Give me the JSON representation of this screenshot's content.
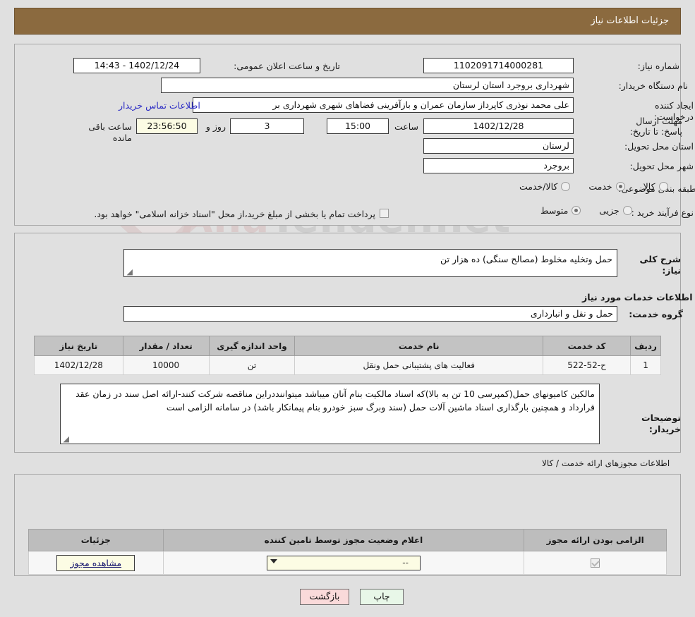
{
  "header": {
    "title": "جزئیات اطلاعات نیاز"
  },
  "need": {
    "number_label": "شماره نیاز:",
    "number_value": "1102091714000281",
    "announce_label": "تاریخ و ساعت اعلان عمومی:",
    "announce_value": "1402/12/24 - 14:43",
    "buyer_org_label": "نام دستگاه خریدار:",
    "buyer_org_value": "شهرداری بروجرد استان لرستان",
    "creator_label": "ایجاد کننده درخواست:",
    "creator_value": "علی محمد نوذری کاپرداز سازمان عمران و بازآفرینی فضاهای شهری شهرداری بر",
    "contact_link": "اطلاعات تماس خریدار",
    "deadline_label": "مهلت ارسال پاسخ: تا تاریخ:",
    "deadline_date": "1402/12/28",
    "time_label": "ساعت",
    "deadline_time": "15:00",
    "days_value": "3",
    "days_label": "روز و",
    "countdown_value": "23:56:50",
    "countdown_label": "ساعت باقی مانده",
    "province_label": "استان محل تحویل:",
    "province_value": "لرستان",
    "city_label": "شهر محل تحویل:",
    "city_value": "بروجرد",
    "category_label": "طبقه بندی موضوعی:",
    "category_options": [
      {
        "label": "کالا",
        "selected": false
      },
      {
        "label": "خدمت",
        "selected": true
      },
      {
        "label": "کالا/خدمت",
        "selected": false
      }
    ],
    "process_label": "نوع فرآیند خرید :",
    "process_options": [
      {
        "label": "جزیی",
        "selected": false
      },
      {
        "label": "متوسط",
        "selected": true
      }
    ],
    "treasury_checkbox_checked": false,
    "treasury_note": "پرداخت تمام یا بخشی از مبلغ خرید،از محل \"اسناد خزانه اسلامی\" خواهد بود."
  },
  "summary": {
    "label": "شرح کلی نیاز:",
    "value": "حمل وتخلیه مخلوط (مصالح سنگی) ده هزار تن"
  },
  "services_section": {
    "heading": "اطلاعات خدمات مورد نیاز",
    "group_label": "گروه خدمت:",
    "group_value": "حمل و نقل و انبارداری"
  },
  "services_table": {
    "columns": [
      "ردیف",
      "کد خدمت",
      "نام خدمت",
      "واحد اندازه گیری",
      "تعداد / مقدار",
      "تاریخ نیاز"
    ],
    "rows": [
      {
        "row": "1",
        "code": "ح-52-522",
        "name": "فعالیت های پشتیبانی حمل ونقل",
        "unit": "تن",
        "quantity": "10000",
        "date": "1402/12/28"
      }
    ]
  },
  "buyer_notes": {
    "label": "توضیحات خریدار:",
    "value": "مالکین کامیونهای حمل(کمپرسی 10 تن به بالا)که اسناد مالکیت بنام آنان میباشد میتواننددراین مناقصه شرکت کنند-ارائه اصل سند در زمان عقد قرارداد و همچنین بارگذاری اسناد ماشین آلات حمل (سند وبرگ سبز خودرو بنام پیمانکار باشد) در سامانه الزامی است"
  },
  "permits_section": {
    "heading": "اطلاعات مجوزهای ارائه خدمت / کالا",
    "columns": [
      "الزامی بودن ارائه مجوز",
      "اعلام وضعیت مجوز توسط تامین کننده",
      "جزئیات"
    ],
    "rows": [
      {
        "required_checked": true,
        "status_value": "--",
        "details_button": "مشاهده مجوز"
      }
    ]
  },
  "footer": {
    "print_label": "چاپ",
    "back_label": "بازگشت"
  },
  "watermark": {
    "text_left": "Ana",
    "text_right": "Tender",
    "text_tail": ".net"
  },
  "colors": {
    "header_bg": "#8b6a3f",
    "page_bg": "#e0e0e0",
    "link": "#2b2bc4",
    "cream_field": "#fcfce4",
    "print_btn": "#e8f7e8",
    "back_btn": "#fadada"
  }
}
